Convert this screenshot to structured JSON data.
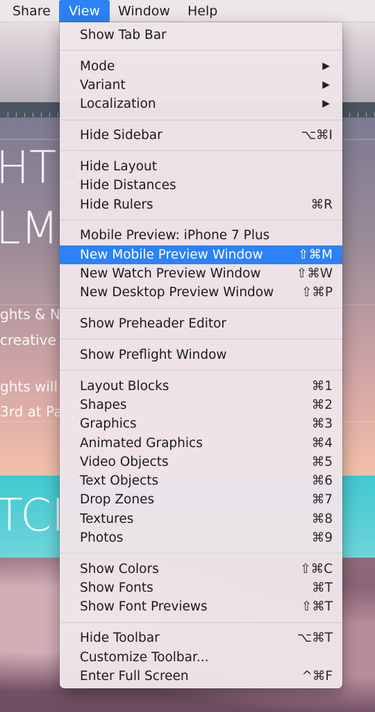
{
  "menubar": {
    "items": [
      "Share",
      "View",
      "Window",
      "Help"
    ]
  },
  "background": {
    "headline_1": "HTS",
    "headline_2": "LM",
    "para_1": "ghts & Ni",
    "para_2": "creative",
    "para_3": "ghts will",
    "para_4": "3rd at Pa",
    "headline_3": "TCI"
  },
  "menu": {
    "groups": [
      [
        {
          "label": "Show Tab Bar",
          "shortcut": ""
        }
      ],
      [
        {
          "label": "Mode",
          "shortcut": "",
          "submenu": "▶"
        },
        {
          "label": "Variant",
          "shortcut": "",
          "submenu": "▶"
        },
        {
          "label": "Localization",
          "shortcut": "",
          "submenu": "▶"
        }
      ],
      [
        {
          "label": "Hide Sidebar",
          "shortcut": "⌥⌘I"
        }
      ],
      [
        {
          "label": "Hide Layout",
          "shortcut": ""
        },
        {
          "label": "Hide Distances",
          "shortcut": ""
        },
        {
          "label": "Hide Rulers",
          "shortcut": "⌘R"
        }
      ],
      [
        {
          "label": "Mobile Preview: iPhone 7 Plus",
          "shortcut": ""
        },
        {
          "label": "New Mobile Preview Window",
          "shortcut": "⇧⌘M",
          "highlighted": true
        },
        {
          "label": "New Watch Preview Window",
          "shortcut": "⇧⌘W"
        },
        {
          "label": "New Desktop Preview Window",
          "shortcut": "⇧⌘P"
        }
      ],
      [
        {
          "label": "Show Preheader Editor",
          "shortcut": ""
        }
      ],
      [
        {
          "label": "Show Preflight Window",
          "shortcut": ""
        }
      ],
      [
        {
          "label": "Layout Blocks",
          "shortcut": "⌘1"
        },
        {
          "label": "Shapes",
          "shortcut": "⌘2"
        },
        {
          "label": "Graphics",
          "shortcut": "⌘3"
        },
        {
          "label": "Animated Graphics",
          "shortcut": "⌘4"
        },
        {
          "label": "Video Objects",
          "shortcut": "⌘5"
        },
        {
          "label": "Text Objects",
          "shortcut": "⌘6"
        },
        {
          "label": "Drop Zones",
          "shortcut": "⌘7"
        },
        {
          "label": "Textures",
          "shortcut": "⌘8"
        },
        {
          "label": "Photos",
          "shortcut": "⌘9"
        }
      ],
      [
        {
          "label": "Show Colors",
          "shortcut": "⇧⌘C"
        },
        {
          "label": "Show Fonts",
          "shortcut": "⌘T"
        },
        {
          "label": "Show Font Previews",
          "shortcut": "⇧⌘T"
        }
      ],
      [
        {
          "label": "Hide Toolbar",
          "shortcut": "⌥⌘T"
        },
        {
          "label": "Customize Toolbar...",
          "shortcut": ""
        },
        {
          "label": "Enter Full Screen",
          "shortcut": "^⌘F"
        }
      ]
    ]
  },
  "colors": {
    "highlight": "#2c82f6",
    "teal_band": "#3fc8d0"
  }
}
